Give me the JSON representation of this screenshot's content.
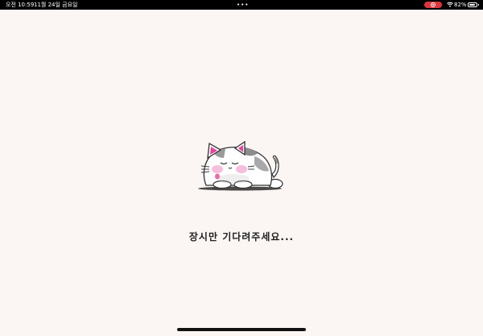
{
  "status_bar": {
    "time": "오전 10:59",
    "date": "11월 24일 금요일",
    "multitask_dots": "•••",
    "battery_percent": "82%",
    "battery_level": 0.82
  },
  "main": {
    "loading_message": "장시만 기다려주세요..."
  },
  "colors": {
    "background": "#fbf6f4",
    "status_bar": "#000000",
    "record_indicator": "#e0343d",
    "ear_pink": "#e8439a"
  },
  "icons": [
    "record-icon",
    "wifi-icon",
    "battery-icon",
    "sleeping-cat-icon"
  ]
}
